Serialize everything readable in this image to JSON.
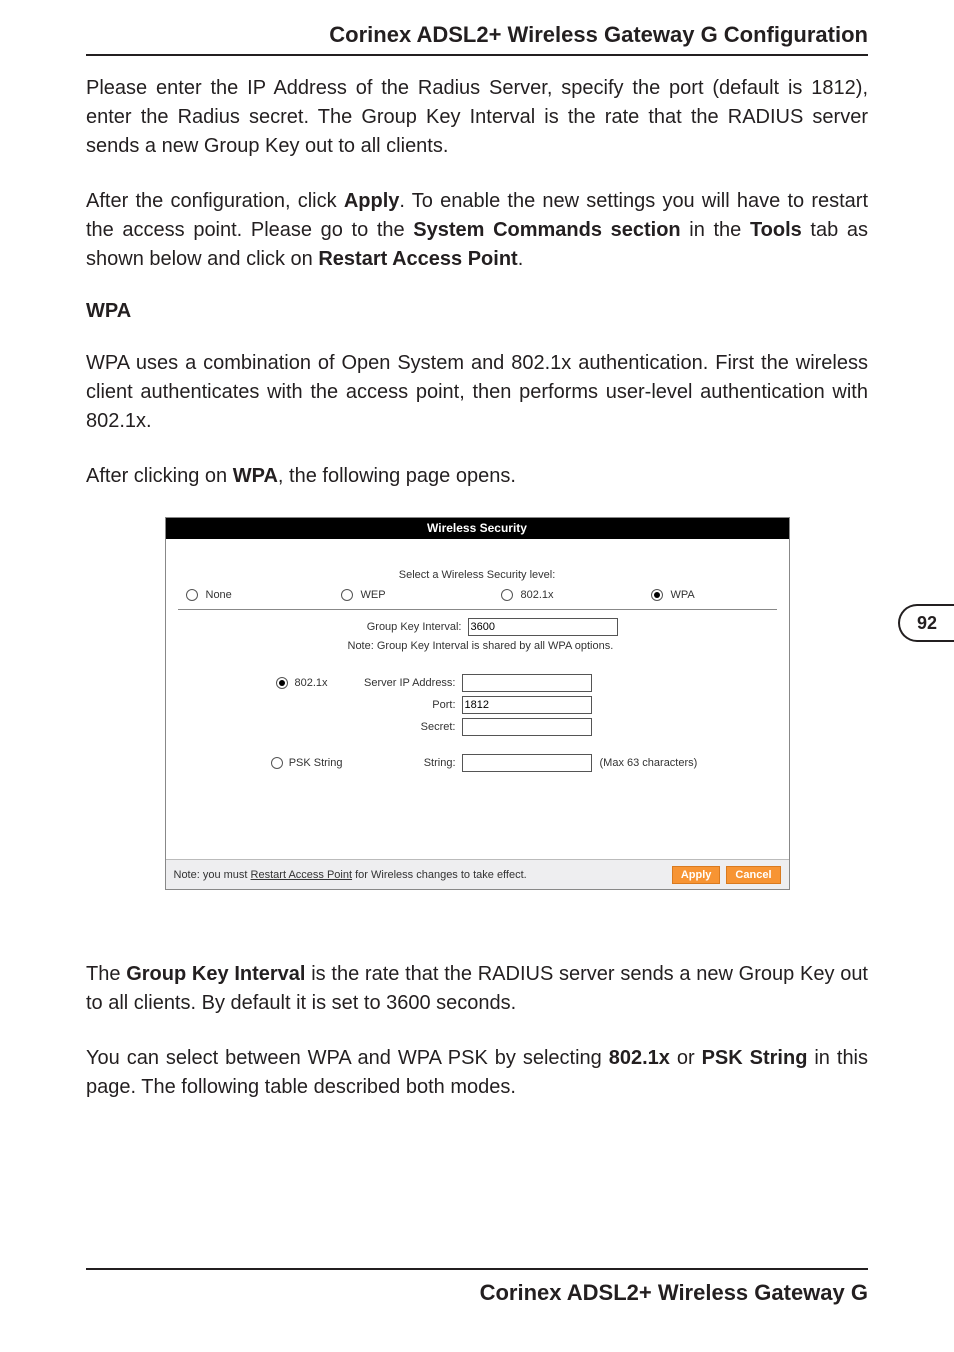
{
  "header": {
    "title": "Corinex ADSL2+ Wireless Gateway G Configuration"
  },
  "page_number": "92",
  "para1": "Please enter the IP Address of the Radius Server, specify the port (default is 1812), enter the Radius secret. The Group Key Interval is the rate that the RADIUS server sends a new Group Key out to all clients.",
  "para2": {
    "pre": "After the configuration, click ",
    "b1": "Apply",
    "mid1": ". To enable the new settings you will have to restart the access point. Please go to the ",
    "b2": "System Commands section",
    "mid2": " in the ",
    "b3": "Tools",
    "mid3": " tab as shown below and click on ",
    "b4": "Restart Access Point",
    "post": "."
  },
  "section_heading": "WPA",
  "para3": "WPA uses a combination of Open System and 802.1x authentication. First the wireless client authenticates with the access point, then performs user-level authentication with 802.1x.",
  "para4": {
    "pre": "After clicking on ",
    "b1": "WPA",
    "post": ", the following page opens."
  },
  "screenshot": {
    "title": "Wireless Security",
    "select_label": "Select a Wireless Security level:",
    "options": {
      "none": "None",
      "wep": "WEP",
      "x802": "802.1x",
      "wpa": "WPA"
    },
    "group_key_label": "Group Key Interval:",
    "group_key_value": "3600",
    "group_key_note": "Note: Group Key Interval is shared by all WPA options.",
    "mode_8021x": "802.1x",
    "server_ip_label": "Server IP Address:",
    "server_ip_value": "",
    "port_label": "Port:",
    "port_value": "1812",
    "secret_label": "Secret:",
    "secret_value": "",
    "mode_psk": "PSK String",
    "string_label": "String:",
    "string_value": "",
    "string_hint": "(Max 63 characters)",
    "footer_note_pre": "Note: you must ",
    "footer_note_link": "Restart Access Point",
    "footer_note_post": " for Wireless changes to take effect.",
    "apply": "Apply",
    "cancel": "Cancel"
  },
  "para5": {
    "pre": "The ",
    "b1": "Group Key Interval",
    "post": " is the rate that the RADIUS server sends a new Group Key out to all clients. By default it is set to 3600 seconds."
  },
  "para6": {
    "pre": "You can select between WPA and WPA PSK by selecting ",
    "b1": "802.1x",
    "mid": " or ",
    "b2": "PSK String",
    "post": " in this page. The following table described both modes."
  },
  "footer": {
    "title": "Corinex ADSL2+ Wireless Gateway G"
  }
}
